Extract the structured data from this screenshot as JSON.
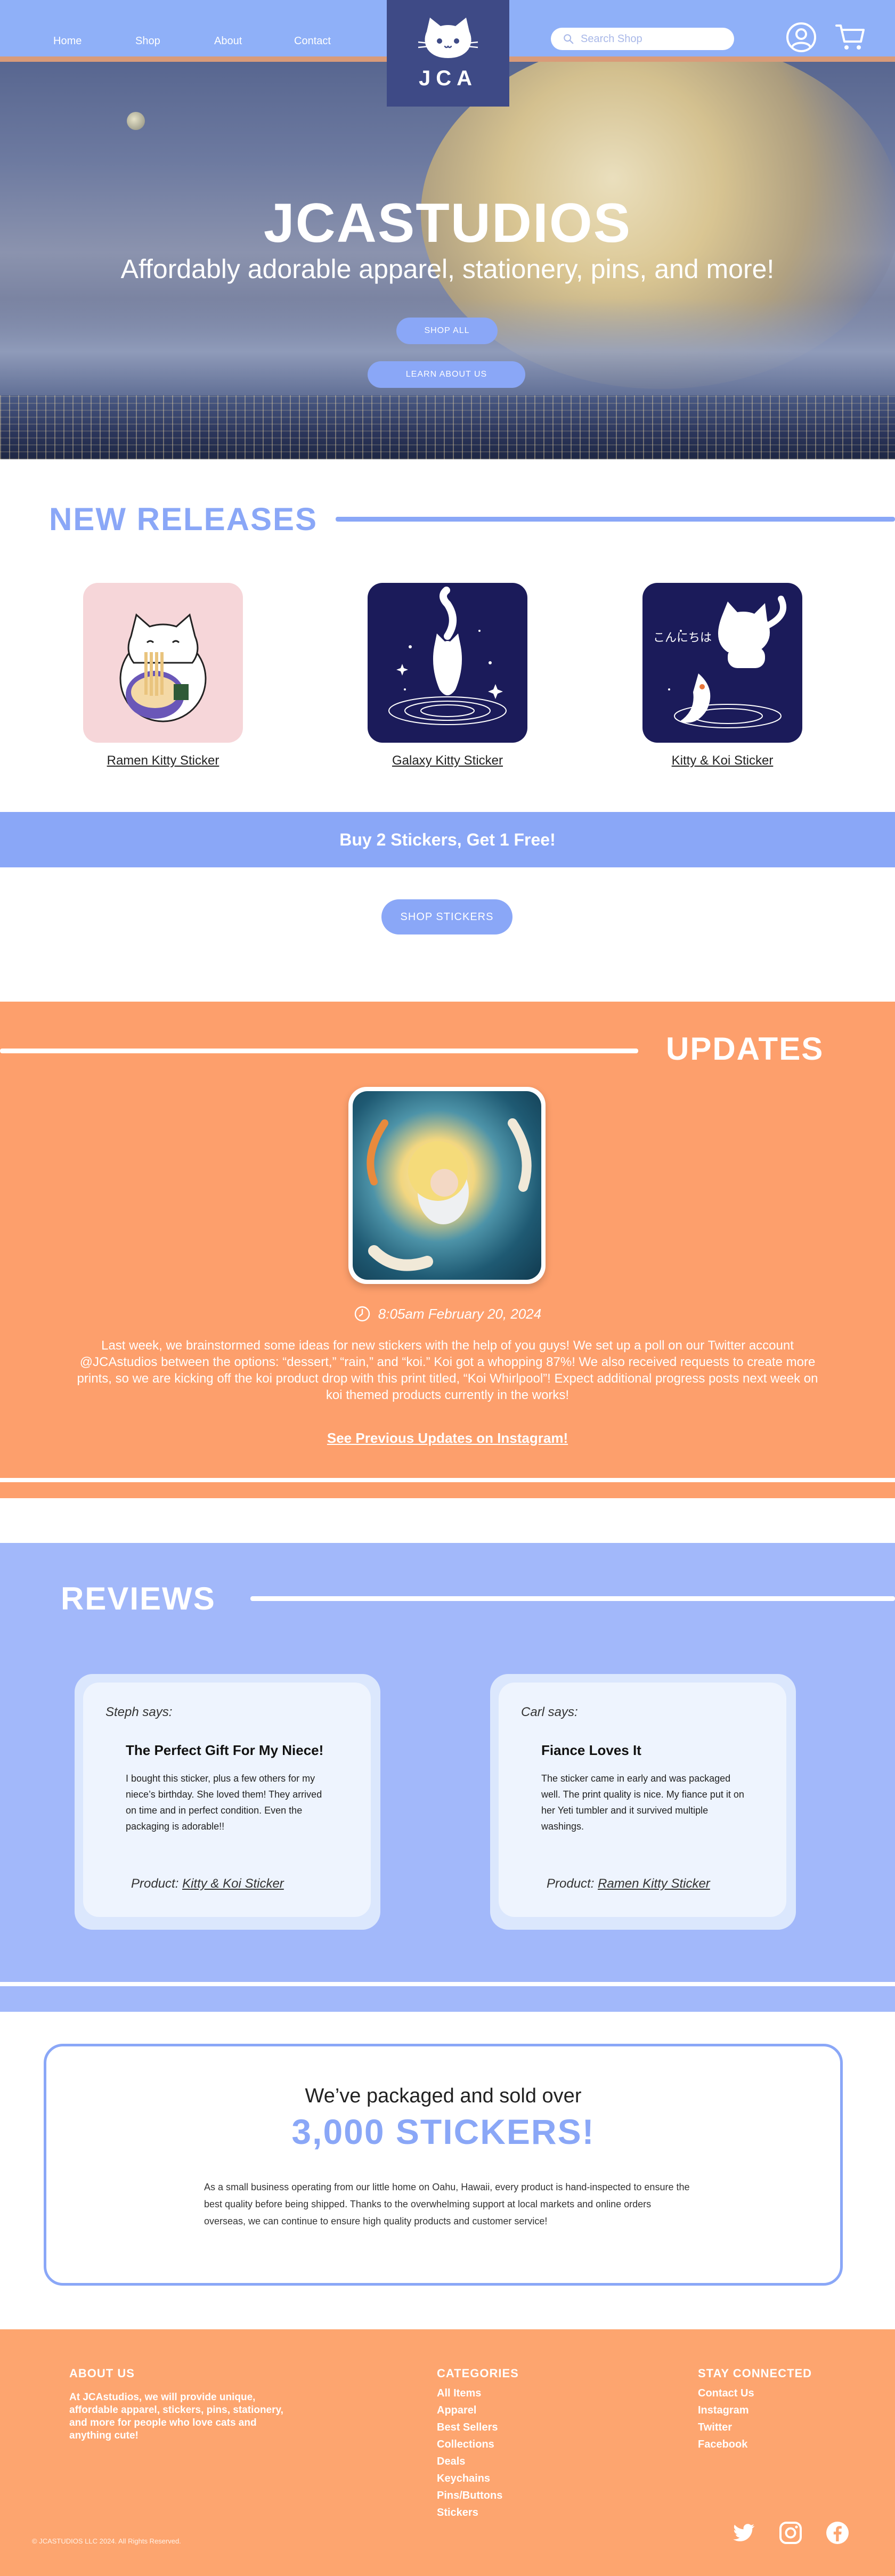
{
  "nav": {
    "home": "Home",
    "shop": "Shop",
    "about": "About",
    "contact": "Contact",
    "logo_text": "JCA",
    "search_placeholder": "Search Shop"
  },
  "hero": {
    "title": "JCASTUDIOS",
    "subtitle": "Affordably adorable apparel, stationery, pins, and more!",
    "shop_all": "SHOP ALL",
    "learn_about": "LEARN ABOUT US"
  },
  "new_releases": {
    "title": "NEW RELEASES",
    "products": [
      {
        "name": "Ramen Kitty Sticker"
      },
      {
        "name": "Galaxy Kitty Sticker"
      },
      {
        "name": "Kitty & Koi Sticker",
        "japanese": "こんにちは"
      }
    ],
    "promo": "Buy 2 Stickers, Get 1 Free!",
    "shop_stickers": "SHOP STICKERS"
  },
  "updates": {
    "title": "UPDATES",
    "date": "8:05am February 20, 2024",
    "body": "Last week, we brainstormed some ideas for new stickers with the help of you guys! We set up a poll on our Twitter account @JCAstudios between the options: “dessert,” “rain,” and “koi.” Koi got a whopping 87%! We also received requests to create more prints, so we are kicking off the koi product drop with this print titled, “Koi Whirlpool”! Expect additional progress posts next week on koi themed products currently in the works!",
    "link": "See Previous Updates on Instagram!"
  },
  "reviews": {
    "title": "REVIEWS",
    "items": [
      {
        "author": "Steph says:",
        "headline": "The Perfect Gift For My Niece!",
        "text": "I bought this sticker, plus a few others for my niece’s birthday. She loved them! They arrived on time and in perfect condition. Even the packaging is adorable!!",
        "product_label": "Product:",
        "product": "Kitty & Koi Sticker"
      },
      {
        "author": "Carl says:",
        "headline": "Fiance Loves It",
        "text": "The sticker came in early and was packaged well. The print quality is nice. My fiance put it on her Yeti tumbler and it survived multiple washings.",
        "product_label": "Product:",
        "product": "Ramen Kitty Sticker"
      }
    ]
  },
  "stats": {
    "lead": "We’ve packaged and sold over",
    "big": "3,000 STICKERS!",
    "body": "As a small business operating from our little home on Oahu, Hawaii, every product is hand-inspected to ensure the best quality before being shipped. Thanks to the overwhelming support at local markets and online orders overseas, we can continue to ensure high quality products and customer service!"
  },
  "footer": {
    "about_title": "ABOUT US",
    "about_text": "At JCAstudios, we will provide unique, affordable apparel, stickers, pins, stationery, and more for people who love cats and anything cute!",
    "categories_title": "CATEGORIES",
    "categories": [
      "All Items",
      "Apparel",
      "Best Sellers",
      "Collections",
      "Deals",
      "Keychains",
      "Pins/Buttons",
      "Stickers"
    ],
    "connect_title": "STAY CONNECTED",
    "connect": [
      "Contact Us",
      "Instagram",
      "Twitter",
      "Facebook"
    ],
    "copyright": "© JCASTUDIOS LLC 2024. All Rights Reserved."
  },
  "colors": {
    "accent_blue": "#8aa7f7",
    "orange": "#fd9f6c",
    "navy": "#3e4a86"
  },
  "icons": [
    "search-icon",
    "user-icon",
    "cart-icon",
    "clock-icon",
    "twitter-icon",
    "instagram-icon",
    "facebook-icon"
  ]
}
